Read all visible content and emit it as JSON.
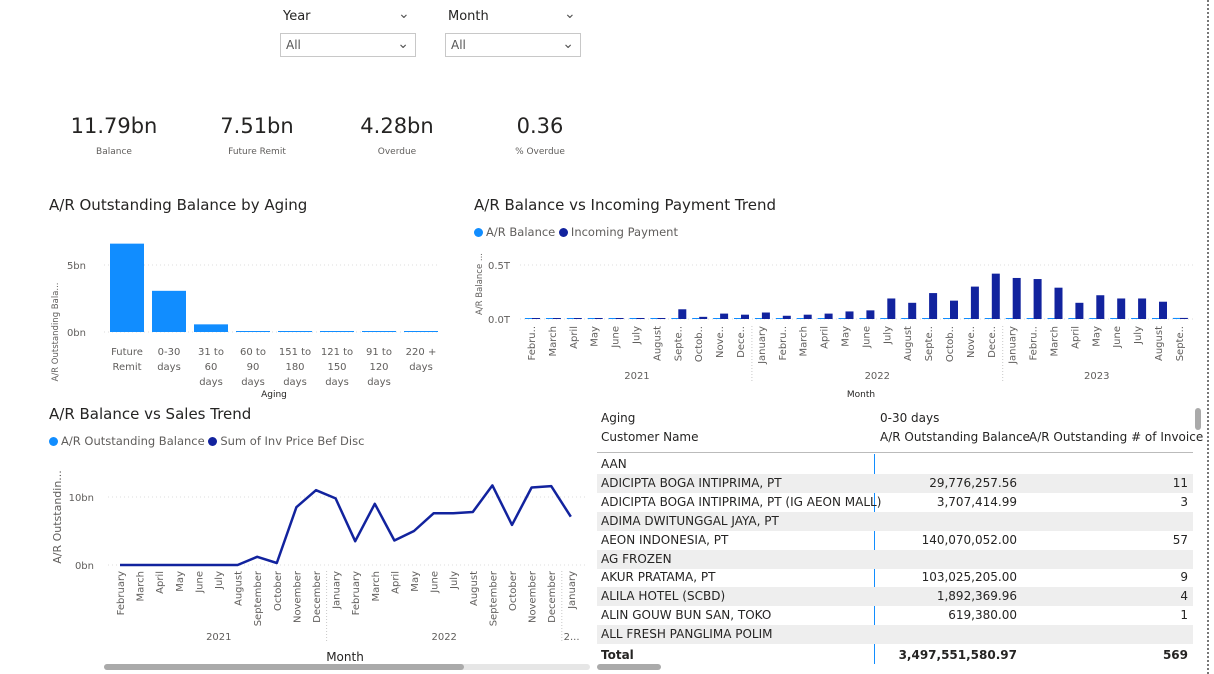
{
  "filters": {
    "year": {
      "label": "Year",
      "value": "All"
    },
    "month": {
      "label": "Month",
      "value": "All"
    }
  },
  "kpis": [
    {
      "value": "11.79bn",
      "label": "Balance"
    },
    {
      "value": "7.51bn",
      "label": "Future Remit"
    },
    {
      "value": "4.28bn",
      "label": "Overdue"
    },
    {
      "value": "0.36",
      "label": "% Overdue"
    }
  ],
  "colors": {
    "light_blue": "#118DFF",
    "dark_blue": "#12239E",
    "grid": "#dddddd"
  },
  "aging_chart": {
    "title": "A/R Outstanding Balance by Aging",
    "ylabel": "A/R Outstanding Bala...",
    "xlabel": "Aging",
    "yticks": [
      "5bn",
      "0bn"
    ]
  },
  "trend_chart": {
    "title": "A/R Balance vs Incoming Payment Trend",
    "legend": [
      "A/R Balance",
      "Incoming Payment"
    ],
    "ylabel": "A/R Balance ...",
    "xlabel": "Month",
    "yticks": [
      "0.5T",
      "0.0T"
    ],
    "years": [
      "2021",
      "2022",
      "2023"
    ]
  },
  "sales_chart": {
    "title": "A/R Balance vs Sales Trend",
    "legend": [
      "A/R Outstanding Balance",
      "Sum of Inv Price Bef Disc"
    ],
    "ylabel": "A/R Outstandin...",
    "xlabel": "Month",
    "yticks": [
      "10bn",
      "0bn"
    ],
    "years": [
      "2021",
      "2022",
      "2..."
    ]
  },
  "chart_data": [
    {
      "type": "bar",
      "title": "A/R Outstanding Balance by Aging",
      "categories": [
        "Future Remit",
        "0-30 days",
        "31 to 60 days",
        "60 to 90 days",
        "151 to 180 days",
        "121 to 150 days",
        "91 to 120 days",
        "220 + days"
      ],
      "values": [
        7.51,
        3.5,
        0.65,
        0.06,
        0.03,
        0.03,
        0.02,
        0.02
      ],
      "unit": "bn",
      "ylim": [
        0,
        8.5
      ],
      "xlabel": "Aging",
      "ylabel": "A/R Outstanding Bala..."
    },
    {
      "type": "bar",
      "title": "A/R Balance vs Incoming Payment Trend",
      "categories": [
        "Febru..",
        "March",
        "April",
        "May",
        "June",
        "July",
        "August",
        "Septe..",
        "Octob..",
        "Nove..",
        "Dece..",
        "January",
        "Febru..",
        "March",
        "April",
        "May",
        "June",
        "July",
        "August",
        "Septe..",
        "Octob..",
        "Nove..",
        "Dece..",
        "January",
        "Febru..",
        "March",
        "April",
        "May",
        "June",
        "July",
        "August",
        "Septe.."
      ],
      "series": [
        {
          "name": "A/R Balance",
          "values": [
            0.004,
            0.004,
            0.004,
            0.004,
            0.004,
            0.004,
            0.004,
            0.004,
            0.004,
            0.004,
            0.004,
            0.004,
            0.004,
            0.004,
            0.004,
            0.004,
            0.004,
            0.004,
            0.004,
            0.004,
            0.004,
            0.004,
            0.004,
            0.004,
            0.004,
            0.004,
            0.004,
            0.004,
            0.004,
            0.004,
            0.004,
            0.01
          ]
        },
        {
          "name": "Incoming Payment",
          "values": [
            0.004,
            0.005,
            0.005,
            0.005,
            0.005,
            0.005,
            0.006,
            0.09,
            0.02,
            0.05,
            0.04,
            0.06,
            0.03,
            0.04,
            0.05,
            0.07,
            0.08,
            0.19,
            0.15,
            0.24,
            0.17,
            0.3,
            0.42,
            0.38,
            0.37,
            0.29,
            0.15,
            0.22,
            0.19,
            0.19,
            0.16,
            0.01
          ]
        }
      ],
      "unit": "T",
      "ylim": [
        0,
        0.5
      ],
      "xlabel": "Month",
      "ylabel": "A/R Balance ...",
      "year_groups": [
        {
          "label": "2021",
          "count": 11
        },
        {
          "label": "2022",
          "count": 12
        },
        {
          "label": "2023",
          "count": 9
        }
      ]
    },
    {
      "type": "line",
      "title": "A/R Balance vs Sales Trend",
      "categories": [
        "February",
        "March",
        "April",
        "May",
        "June",
        "July",
        "August",
        "September",
        "October",
        "November",
        "December",
        "January",
        "February",
        "March",
        "April",
        "May",
        "June",
        "July",
        "August",
        "September",
        "October",
        "November",
        "December",
        "January"
      ],
      "series": [
        {
          "name": "Sum of Inv Price Bef Disc",
          "values": [
            0,
            0,
            0,
            0,
            0,
            0,
            0,
            1.2,
            0.3,
            8.5,
            11.0,
            9.8,
            3.5,
            9.0,
            3.6,
            5.0,
            7.6,
            7.6,
            7.8,
            11.7,
            5.9,
            11.4,
            11.6,
            7.1
          ]
        }
      ],
      "unit": "bn",
      "ylim": [
        0,
        14
      ],
      "xlabel": "Month",
      "ylabel": "A/R Outstandin...",
      "year_groups": [
        {
          "label": "2021",
          "count": 11
        },
        {
          "label": "2022",
          "count": 12
        },
        {
          "label": "2...",
          "count": 1
        }
      ]
    }
  ],
  "table": {
    "headers": {
      "row1_col1": "Aging",
      "row1_col2": "0-30 days",
      "col_name": "Customer Name",
      "col_balance": "A/R Outstanding Balance",
      "col_count": "A/R Outstanding # of Invoice"
    },
    "rows": [
      {
        "name": "AAN",
        "balance": "",
        "count": ""
      },
      {
        "name": "ADICIPTA BOGA INTIPRIMA, PT",
        "balance": "29,776,257.56",
        "count": "11"
      },
      {
        "name": "ADICIPTA BOGA INTIPRIMA, PT (IG AEON MALL)",
        "balance": "3,707,414.99",
        "count": "3"
      },
      {
        "name": "ADIMA DWITUNGGAL JAYA, PT",
        "balance": "",
        "count": ""
      },
      {
        "name": "AEON INDONESIA, PT",
        "balance": "140,070,052.00",
        "count": "57"
      },
      {
        "name": "AG FROZEN",
        "balance": "",
        "count": ""
      },
      {
        "name": "AKUR PRATAMA, PT",
        "balance": "103,025,205.00",
        "count": "9"
      },
      {
        "name": "ALILA HOTEL (SCBD)",
        "balance": "1,892,369.96",
        "count": "4"
      },
      {
        "name": "ALIN GOUW BUN SAN, TOKO",
        "balance": "619,380.00",
        "count": "1"
      },
      {
        "name": "ALL FRESH PANGLIMA POLIM",
        "balance": "",
        "count": ""
      }
    ],
    "total": {
      "name": "Total",
      "balance": "3,497,551,580.97",
      "count": "569"
    }
  }
}
